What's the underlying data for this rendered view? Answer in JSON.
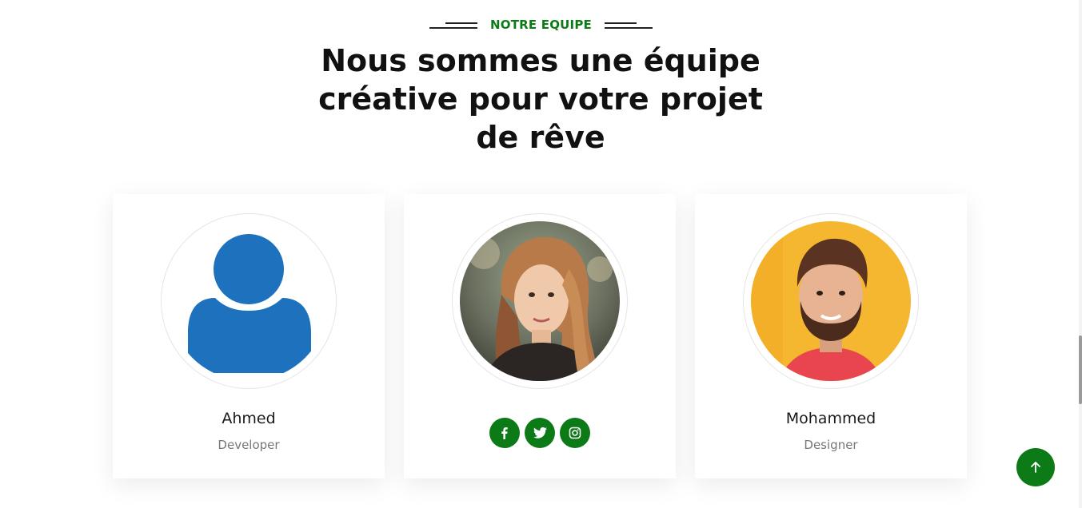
{
  "section": {
    "eyebrow": "NOTRE EQUIPE",
    "title": "Nous sommes une équipe créative pour votre projet de rêve"
  },
  "team": [
    {
      "name": "Ahmed",
      "role": "Developer",
      "avatar": "default-user-icon"
    },
    {
      "name": "",
      "role": "",
      "avatar": "photo-woman",
      "socials": [
        "facebook-icon",
        "twitter-icon",
        "instagram-icon"
      ]
    },
    {
      "name": "Mohammed",
      "role": "Designer",
      "avatar": "photo-man"
    }
  ],
  "colors": {
    "accent": "#0c7a17",
    "title": "#111111",
    "role": "#777777",
    "avatar_default": "#1d71bd",
    "mohammed_bg": "#f4b72f"
  },
  "controls": {
    "back_to_top": "arrow-up-icon"
  }
}
